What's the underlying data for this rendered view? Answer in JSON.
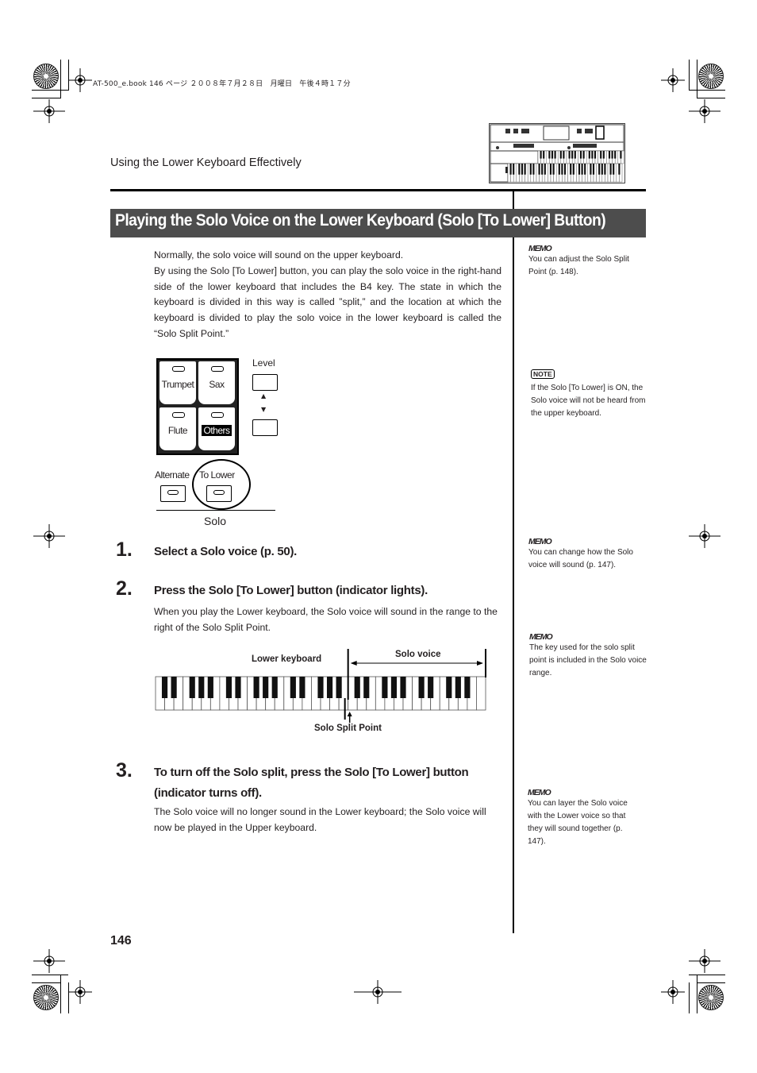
{
  "print_info": "AT-500_e.book  146 ページ  ２００８年７月２８日　月曜日　午後４時１７分",
  "header": {
    "section": "Using the Lower Keyboard Effectively",
    "thumbnail_icon": "organ-panel-thumbnail-icon"
  },
  "title": "Playing the Solo Voice on the Lower Keyboard (Solo [To Lower] Button)",
  "intro": [
    "Normally, the solo voice will sound on the upper keyboard.",
    "By using the Solo [To Lower] button, you can play the solo voice in the right-hand side of the lower keyboard that includes the B4 key. The state in which the keyboard is divided in this way is called ”split,” and the location at which the keyboard is divided to play the solo voice in the lower keyboard is called the “Solo Split Point.”"
  ],
  "panel_diagram": {
    "voice_buttons": [
      "Trumpet",
      "Sax",
      "Flute",
      "Others"
    ],
    "selected_voice": "Others",
    "level_label": "Level",
    "alternate_label": "Alternate",
    "to_lower_label": "To Lower",
    "group_label": "Solo"
  },
  "steps": [
    {
      "number": "1.",
      "title": "Select a Solo voice (p. 50).",
      "body": ""
    },
    {
      "number": "2.",
      "title": "Press the Solo [To Lower] button (indicator lights).",
      "body": "When you play the Lower keyboard, the Solo voice will sound in the range to the right of the Solo Split Point."
    },
    {
      "number": "3.",
      "title": "To turn off the Solo split, press the Solo [To Lower] button (indicator turns off).",
      "body": "The Solo voice will no longer sound in the Lower keyboard; the Solo voice will now be played in the Upper keyboard."
    }
  ],
  "keyboard_diagram": {
    "lower_label": "Lower keyboard",
    "solo_label": "Solo voice",
    "split_label": "Solo Split Point",
    "white_keys": 36,
    "split_after_white_key": 21
  },
  "sidebar": [
    {
      "type": "MEMO",
      "text": "You can adjust the Solo Split Point (p. 148)."
    },
    {
      "type": "NOTE",
      "text": "If the Solo [To Lower] is ON, the Solo voice will not be heard from the upper keyboard."
    },
    {
      "type": "MEMO",
      "text": "You can change how the Solo voice will sound (p. 147)."
    },
    {
      "type": "MEMO",
      "text": "The key used for the solo split point is included in the Solo voice range."
    },
    {
      "type": "MEMO",
      "text": "You can layer the Solo voice with the Lower voice so that they will sound together (p. 147)."
    }
  ],
  "page_number": "146"
}
